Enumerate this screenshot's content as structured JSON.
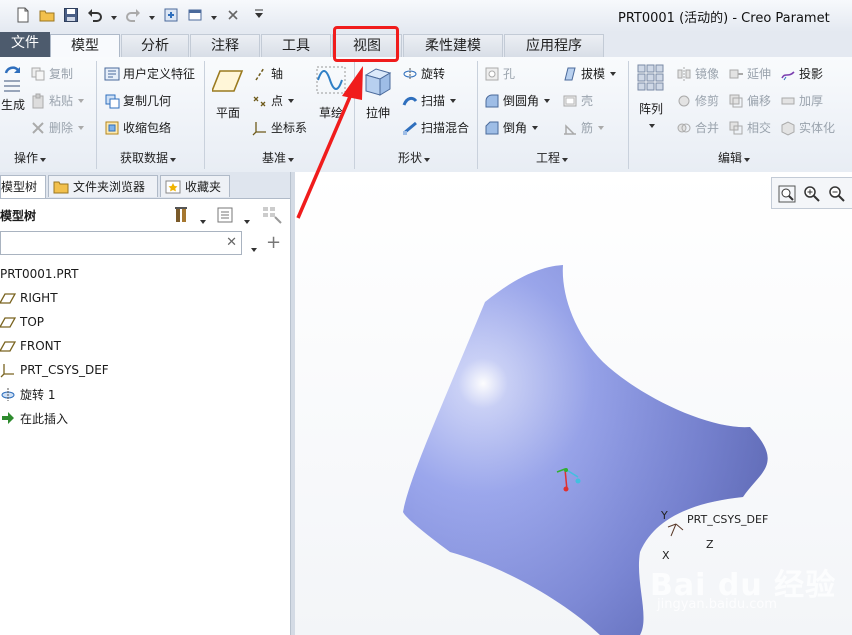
{
  "window": {
    "title": "PRT0001 (活动的) - Creo Paramet"
  },
  "quick_access": {
    "icons": [
      "new-icon",
      "open-icon",
      "save-icon",
      "undo-icon",
      "redo-icon",
      "regenerate-icon",
      "window-icon",
      "close-window-icon",
      "customize-icon"
    ]
  },
  "tabs": [
    {
      "label": "文件"
    },
    {
      "label": "模型"
    },
    {
      "label": "分析"
    },
    {
      "label": "注释"
    },
    {
      "label": "工具"
    },
    {
      "label": "视图"
    },
    {
      "label": "柔性建模"
    },
    {
      "label": "应用程序"
    }
  ],
  "ribbon": {
    "operations": {
      "label": "操作",
      "regen": "生成",
      "copy": "复制",
      "paste": "粘贴",
      "delete": "删除"
    },
    "get_data": {
      "label": "获取数据",
      "udf": "用户定义特征",
      "copy_geom": "复制几何",
      "shrinkwrap": "收缩包络"
    },
    "datum": {
      "label": "基准",
      "plane": "平面",
      "axis": "轴",
      "point": "点",
      "csys": "坐标系",
      "sketch": "草绘"
    },
    "shapes": {
      "label": "形状",
      "extrude": "拉伸",
      "revolve": "旋转",
      "sweep": "扫描",
      "swept_blend": "扫描混合"
    },
    "engineering": {
      "label": "工程",
      "hole": "孔",
      "draft": "拔模",
      "round": "倒圆角",
      "shell": "壳",
      "chamfer": "倒角",
      "rib": "筋"
    },
    "editing": {
      "label": "编辑",
      "pattern": "阵列",
      "mirror": "镜像",
      "extend": "延伸",
      "project": "投影",
      "trim": "修剪",
      "offset": "偏移",
      "thicken": "加厚",
      "merge": "合并",
      "intersect": "相交",
      "solidify": "实体化"
    }
  },
  "left_panel": {
    "tabs": [
      {
        "label": "模型树"
      },
      {
        "label": "文件夹浏览器"
      },
      {
        "label": "收藏夹"
      }
    ],
    "title": "模型树",
    "search_value": "",
    "tree": [
      {
        "label": "PRT0001.PRT",
        "icon": "part-icon"
      },
      {
        "label": "RIGHT",
        "icon": "datum-plane-icon"
      },
      {
        "label": "TOP",
        "icon": "datum-plane-icon"
      },
      {
        "label": "FRONT",
        "icon": "datum-plane-icon"
      },
      {
        "label": "PRT_CSYS_DEF",
        "icon": "csys-icon"
      },
      {
        "label": "旋转 1",
        "icon": "revolve-icon"
      },
      {
        "label": "在此插入",
        "icon": "insert-arrow-icon"
      }
    ]
  },
  "graphics": {
    "csys": {
      "name": "PRT_CSYS_DEF",
      "x": "X",
      "y": "Y",
      "z": "Z"
    },
    "watermark": "Bai du 经验",
    "watermark_sub": "jingyan.baidu.com"
  },
  "colors": {
    "surface": "#8f9be8",
    "highlight": "#f01c1c",
    "ribbon_bg": "#f0f4f9"
  }
}
